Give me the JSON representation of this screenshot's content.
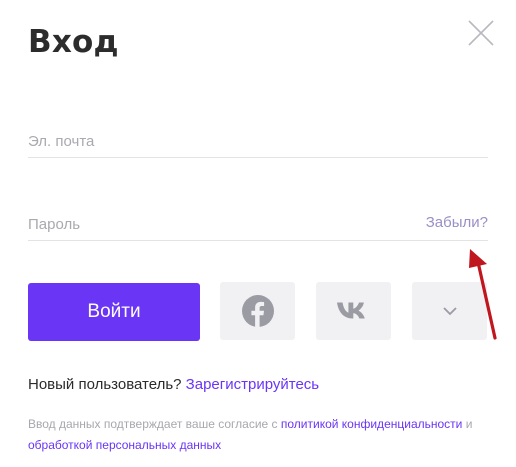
{
  "dialog": {
    "title": "Вход",
    "close_icon": "close-icon"
  },
  "form": {
    "email_placeholder": "Эл. почта",
    "email_value": "",
    "password_placeholder": "Пароль",
    "password_value": "",
    "forgot_label": "Забыли?",
    "submit_label": "Войти"
  },
  "social": {
    "facebook_icon": "facebook-icon",
    "vk_icon": "vk-icon",
    "more_icon": "chevron-down-icon"
  },
  "register": {
    "prompt": "Новый пользователь?",
    "link": "Зарегистрируйтесь"
  },
  "consent": {
    "text_before": "Ввод данных подтверждает ваше согласие с",
    "policy_link": "политикой конфиденциальности",
    "and": "и",
    "processing_link": "обработкой персональных данных"
  },
  "colors": {
    "accent": "#6a35f5",
    "forgot_link": "#9a8fc6",
    "annotation_arrow": "#c0161d",
    "social_bg": "#f1f1f4",
    "social_icon": "#9b9ba3"
  }
}
